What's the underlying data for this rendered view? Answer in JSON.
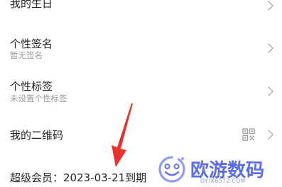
{
  "profile_list": {
    "birthday": {
      "title": "我的生日"
    },
    "signature": {
      "title": "个性签名",
      "subtitle": "暂无签名"
    },
    "tags": {
      "title": "个性标签",
      "subtitle": "未设置个性标签"
    },
    "qrcode": {
      "title": "我的二维码"
    },
    "vip": {
      "text": "超级会员：2023-03-21到期"
    }
  },
  "annotation": {
    "arrow_color": "#e8322c"
  },
  "watermark": {
    "name": "欧游数码",
    "url": "OY.IK6572.COM",
    "color": "#5b6cf0"
  },
  "icons": {
    "chevron": "chevron-right-icon",
    "qrcode": "qrcode-icon"
  }
}
